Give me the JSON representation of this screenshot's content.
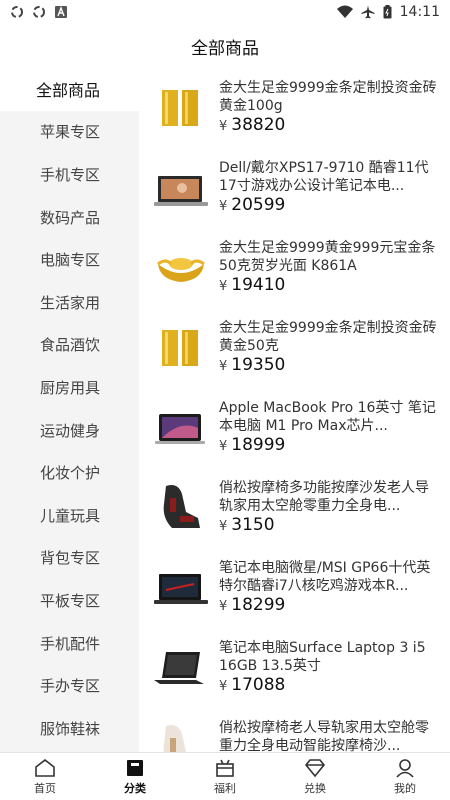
{
  "status_bar": {
    "time": "14:11",
    "left_icons": [
      "sync-icon",
      "sync-icon",
      "notification-a-icon"
    ],
    "right_icons": [
      "wifi-icon",
      "airplane-icon",
      "battery-icon"
    ]
  },
  "header": {
    "title": "全部商品"
  },
  "sidebar": {
    "items": [
      {
        "label": "全部商品",
        "active": true
      },
      {
        "label": "苹果专区"
      },
      {
        "label": "手机专区"
      },
      {
        "label": "数码产品"
      },
      {
        "label": "电脑专区"
      },
      {
        "label": "生活家用"
      },
      {
        "label": "食品酒饮"
      },
      {
        "label": "厨房用具"
      },
      {
        "label": "运动健身"
      },
      {
        "label": "化妆个护"
      },
      {
        "label": "儿童玩具"
      },
      {
        "label": "背包专区"
      },
      {
        "label": "平板专区"
      },
      {
        "label": "手机配件"
      },
      {
        "label": "手办专区"
      },
      {
        "label": "服饰鞋袜"
      }
    ]
  },
  "currency_symbol": "¥",
  "products": [
    {
      "name": "金大生足金9999金条定制投资金砖黄金100g",
      "price": "38820",
      "image": "gold-bar-icon"
    },
    {
      "name": "Dell/戴尔XPS17-9710 酷睿11代 17寸游戏办公设计笔记本电...",
      "price": "20599",
      "image": "laptop-icon"
    },
    {
      "name": "金大生足金9999黄金999元宝金条50克贺岁光面 K861A",
      "price": "19410",
      "image": "gold-ingot-icon"
    },
    {
      "name": "金大生足金9999金条定制投资金砖黄金50克",
      "price": "19350",
      "image": "gold-bar-icon"
    },
    {
      "name": "Apple MacBook Pro 16英寸 笔记本电脑 M1 Pro Max芯片...",
      "price": "18999",
      "image": "macbook-icon"
    },
    {
      "name": "俏松按摩椅多功能按摩沙发老人导轨家用太空舱零重力全身电...",
      "price": "3150",
      "image": "massage-chair-icon"
    },
    {
      "name": "笔记本电脑微星/MSI GP66十代英特尔酷睿i7八核吃鸡游戏本R...",
      "price": "18299",
      "image": "gaming-laptop-icon"
    },
    {
      "name": "笔记本电脑Surface Laptop 3 i5 16GB 13.5英寸",
      "price": "17088",
      "image": "surface-laptop-icon"
    },
    {
      "name": "俏松按摩椅老人导轨家用太空舱零重力全身电动智能按摩椅沙...",
      "price": "",
      "image": "massage-chair-white-icon"
    }
  ],
  "bottom_nav": {
    "items": [
      {
        "label": "首页",
        "icon": "home-icon"
      },
      {
        "label": "分类",
        "icon": "category-icon",
        "active": true
      },
      {
        "label": "福利",
        "icon": "gift-icon"
      },
      {
        "label": "兑换",
        "icon": "diamond-icon"
      },
      {
        "label": "我的",
        "icon": "user-icon"
      }
    ]
  }
}
